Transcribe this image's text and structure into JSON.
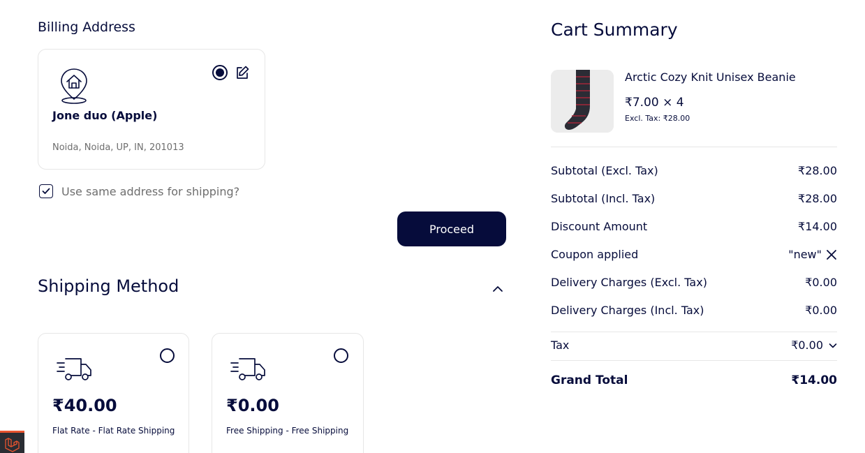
{
  "billing": {
    "title": "Billing Address",
    "address": {
      "name": "Jone duo (Apple)",
      "line": "Noida, Noida, UP, IN, 201013"
    },
    "same_address_label": "Use same address for shipping?",
    "same_address_checked": true,
    "proceed_label": "Proceed"
  },
  "shipping": {
    "title": "Shipping Method",
    "methods": [
      {
        "price": "₹40.00",
        "label": "Flat Rate - Flat Rate Shipping"
      },
      {
        "price": "₹0.00",
        "label": "Free Shipping - Free Shipping"
      }
    ]
  },
  "summary": {
    "title": "Cart Summary",
    "item": {
      "name": "Arctic Cozy Knit Unisex Beanie",
      "price_qty": "₹7.00 × 4",
      "excl_tax": "Excl. Tax: ₹28.00"
    },
    "rows": [
      {
        "label": "Subtotal (Excl. Tax)",
        "value": "₹28.00"
      },
      {
        "label": "Subtotal (Incl. Tax)",
        "value": "₹28.00"
      },
      {
        "label": "Discount Amount",
        "value": "₹14.00"
      },
      {
        "label": "Coupon applied",
        "value": "\"new\""
      },
      {
        "label": "Delivery Charges (Excl. Tax)",
        "value": "₹0.00"
      },
      {
        "label": "Delivery Charges (Incl. Tax)",
        "value": "₹0.00"
      }
    ],
    "tax": {
      "label": "Tax",
      "value": "₹0.00"
    },
    "grand_total": {
      "label": "Grand Total",
      "value": "₹14.00"
    }
  },
  "colors": {
    "primary": "#060C3B",
    "muted_text": "#6E6E6E",
    "border": "#E6E6E6",
    "sock_accent": "#A3263A"
  }
}
